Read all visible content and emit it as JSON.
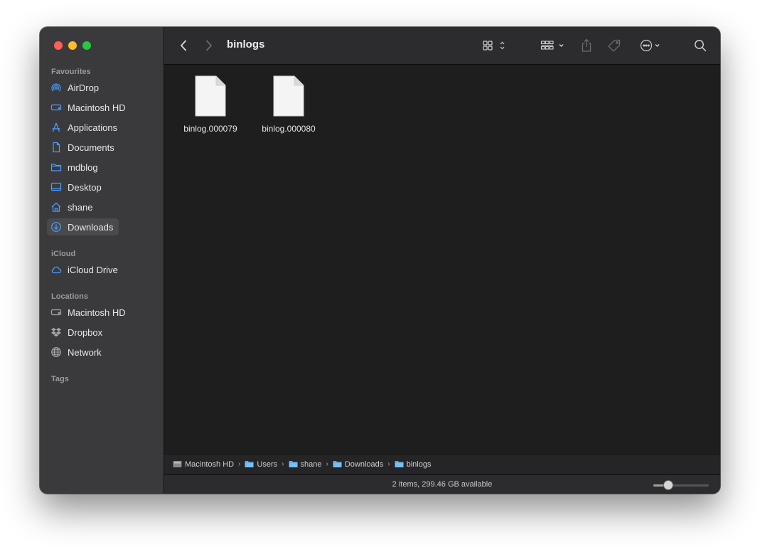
{
  "sidebar": {
    "favourites_title": "Favourites",
    "favourites": [
      {
        "label": "AirDrop",
        "icon": "airdrop-icon"
      },
      {
        "label": "Macintosh HD",
        "icon": "drive-icon"
      },
      {
        "label": "Applications",
        "icon": "applications-icon"
      },
      {
        "label": "Documents",
        "icon": "document-icon"
      },
      {
        "label": "mdblog",
        "icon": "folder-icon"
      },
      {
        "label": "Desktop",
        "icon": "desktop-icon"
      },
      {
        "label": "shane",
        "icon": "home-icon"
      },
      {
        "label": "Downloads",
        "icon": "downloads-icon",
        "selected": true
      }
    ],
    "icloud_title": "iCloud",
    "icloud": [
      {
        "label": "iCloud Drive",
        "icon": "cloud-icon"
      }
    ],
    "locations_title": "Locations",
    "locations": [
      {
        "label": "Macintosh HD",
        "icon": "drive-icon"
      },
      {
        "label": "Dropbox",
        "icon": "dropbox-icon"
      },
      {
        "label": "Network",
        "icon": "network-icon"
      }
    ],
    "tags_title": "Tags"
  },
  "toolbar": {
    "title": "binlogs",
    "icons": [
      "back-chevron-icon",
      "forward-chevron-icon",
      "icon-view-icon",
      "group-icon",
      "share-icon",
      "tag-icon",
      "more-actions-icon",
      "search-icon"
    ]
  },
  "files": [
    {
      "name": "binlog.000079",
      "icon": "document-icon"
    },
    {
      "name": "binlog.000080",
      "icon": "document-icon"
    }
  ],
  "pathbar": [
    {
      "label": "Macintosh HD",
      "icon": "drive-icon"
    },
    {
      "label": "Users",
      "icon": "folder-icon"
    },
    {
      "label": "shane",
      "icon": "folder-icon"
    },
    {
      "label": "Downloads",
      "icon": "folder-icon"
    },
    {
      "label": "binlogs",
      "icon": "folder-icon"
    }
  ],
  "status": {
    "text": "2 items, 299.46 GB available",
    "zoom_level": 0.27
  },
  "colors": {
    "accent": "#3b82f6",
    "sidebar_bg": "#3a3a3c",
    "content_bg": "#1e1e1e",
    "folder_blue": "#5aa9e6"
  }
}
